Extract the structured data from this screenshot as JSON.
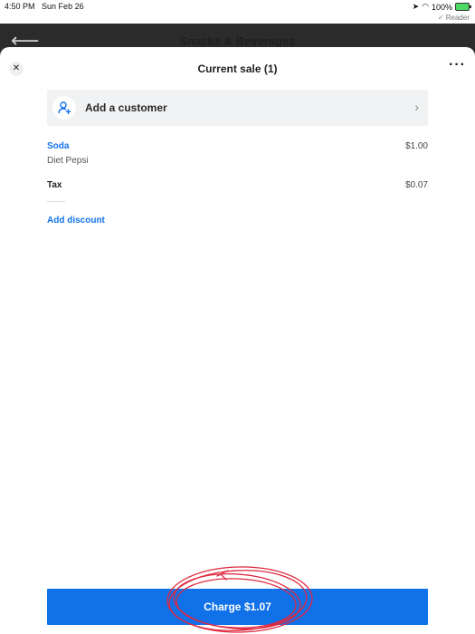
{
  "status_bar": {
    "time": "4:50 PM",
    "date": "Sun Feb 26",
    "battery": "100%",
    "reader": "✓ Reader"
  },
  "background_page": {
    "title": "Snacks & Beverages"
  },
  "sheet": {
    "title": "Current sale (1)",
    "customer": {
      "label": "Add a customer"
    },
    "line_items": [
      {
        "name": "Soda",
        "variant": "Diet Pepsi",
        "price": "$1.00"
      }
    ],
    "tax": {
      "label": "Tax",
      "amount": "$0.07"
    },
    "discount_label": "Add discount",
    "charge_label": "Charge $1.07"
  },
  "colors": {
    "accent": "#1171e9",
    "annotation": "#e0283f"
  }
}
